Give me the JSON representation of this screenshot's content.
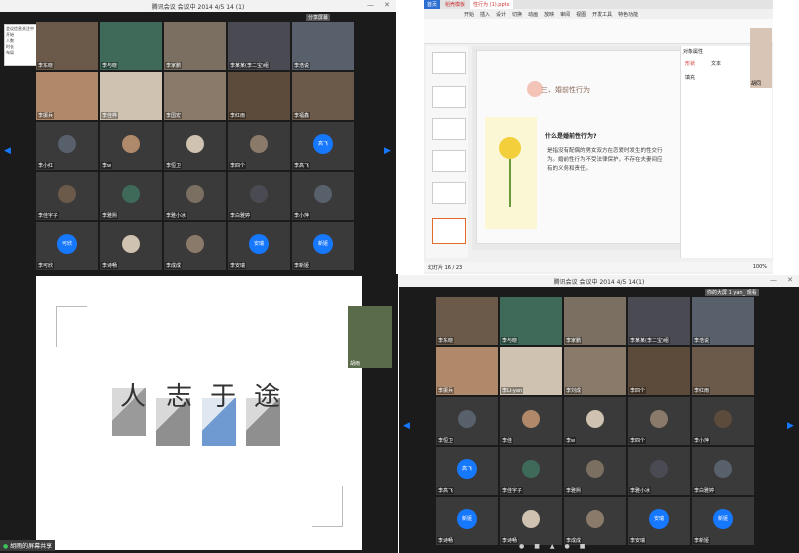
{
  "q1": {
    "title": "腾讯会议 会议中  2014 4/5 14 (1)",
    "share_panel": "分享屏幕",
    "overlay": {
      "title": "会议信息关注中",
      "lines": [
        "开始",
        "人数",
        "时长",
        "布局",
        "设置"
      ]
    },
    "tiles": [
      {
        "name": "李东晓"
      },
      {
        "name": "李与晓"
      },
      {
        "name": "李家鹏"
      },
      {
        "name": "李某某(李二宝)组"
      },
      {
        "name": "李浩说"
      },
      {
        "name": "李振兵"
      },
      {
        "name": "李佳桦"
      },
      {
        "name": "李国宏"
      },
      {
        "name": "李红雨"
      },
      {
        "name": "李福鑫"
      },
      {
        "name": "李小红"
      },
      {
        "name": "李w"
      },
      {
        "name": "李恒卫"
      },
      {
        "name": "李四个"
      },
      {
        "name": "李高飞",
        "bubble": "高飞"
      },
      {
        "name": "李佳宇子"
      },
      {
        "name": "李雅熙"
      },
      {
        "name": "李雅小冰"
      },
      {
        "name": "李白雅婷"
      },
      {
        "name": "李小萍"
      },
      {
        "name": "李可欣",
        "bubble": "可欣"
      },
      {
        "name": "李诗畅"
      },
      {
        "name": "李成成"
      },
      {
        "name": "李安瑞",
        "bubble": "安瑞"
      },
      {
        "name": "李新娅",
        "bubble": "新娅"
      }
    ]
  },
  "q2": {
    "tabs": [
      "首页",
      "稻壳模板",
      "性行为 (1).pptx"
    ],
    "menu": [
      "开始",
      "插入",
      "设计",
      "切换",
      "动画",
      "放映",
      "审阅",
      "视图",
      "开发工具",
      "特色功能"
    ],
    "slide": {
      "heading": "三、婚前性行为",
      "question": "什么是婚前性行为?",
      "body": "是指没有配偶的男女双方在恋爱时发生的性交行为。婚前性行为不受法律保护，不存在夫妻间应有的义务和责任。"
    },
    "presenter": "胡同",
    "panel": {
      "title": "对象属性",
      "tab1": "形状",
      "tab2": "文本",
      "fill": "填充"
    },
    "status": "幻灯片 16 / 23",
    "zoom": "100%"
  },
  "q3": {
    "slide_chars": [
      "人",
      "志",
      "于",
      "途"
    ],
    "presenter": "胡雨",
    "share_label": "胡雨的屏幕共享"
  },
  "q4": {
    "title": "腾讯会议 会议中  2014 4/5 14(1)",
    "share_panel": "你的大屏 1 yan_ 观看",
    "tiles": [
      {
        "name": "李东晓"
      },
      {
        "name": "李与晓"
      },
      {
        "name": "李家鹏"
      },
      {
        "name": "李某某(李二宝)组"
      },
      {
        "name": "李浩说"
      },
      {
        "name": "李振兵"
      },
      {
        "name": "李Li-yan"
      },
      {
        "name": "李刘成"
      },
      {
        "name": "李四个"
      },
      {
        "name": "李红雨"
      },
      {
        "name": "李恒卫"
      },
      {
        "name": "李佳"
      },
      {
        "name": "李w"
      },
      {
        "name": "李四个"
      },
      {
        "name": "李小萍"
      },
      {
        "name": "李高飞",
        "bubble": "高飞"
      },
      {
        "name": "李佳宇子"
      },
      {
        "name": "李雅熙"
      },
      {
        "name": "李雅小冰"
      },
      {
        "name": "李白雅婷"
      },
      {
        "name": "李诗畅",
        "bubble": "新娅"
      },
      {
        "name": "李诗畅"
      },
      {
        "name": "李成成"
      },
      {
        "name": "李安瑞",
        "bubble": "安瑞"
      },
      {
        "name": "李新娅",
        "bubble": "新娅"
      }
    ]
  },
  "colors": {
    "accent": "#1677ff",
    "tile": "#3a3a3a",
    "slide_bg": "#fafafa"
  }
}
